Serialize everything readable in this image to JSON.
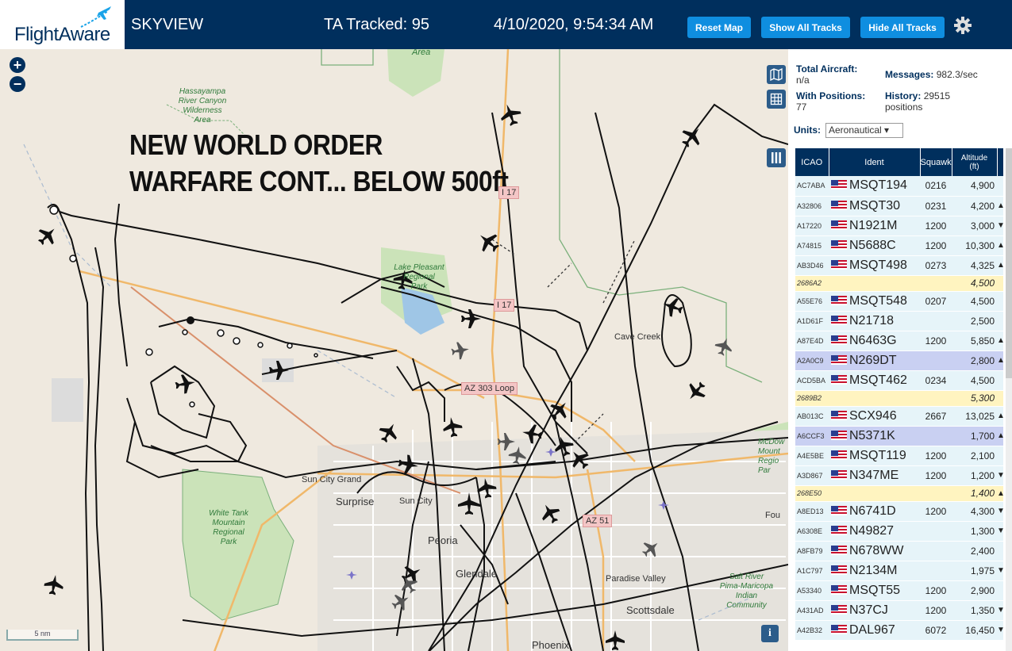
{
  "header": {
    "logo": "FlightAware",
    "app_name": "SKYVIEW",
    "tracked": "TA Tracked: 95",
    "datetime": "4/10/2020, 9:54:34 AM",
    "buttons": {
      "reset": "Reset Map",
      "show_all": "Show All Tracks",
      "hide_all": "Hide All Tracks"
    }
  },
  "map": {
    "zoom_in": "+",
    "zoom_out": "−",
    "overlay_line1": "NEW WORLD ORDER",
    "overlay_line2": "WARFARE CONT... BELOW 500ft",
    "scale": "5 nm",
    "info": "i",
    "places": {
      "sun_city_grand": "Sun City Grand",
      "surprise": "Surprise",
      "sun_city": "Sun City",
      "peoria": "Peoria",
      "glendale": "Glendale",
      "paradise_valley": "Paradise Valley",
      "scottsdale": "Scottsdale",
      "phoenix": "Phoenix",
      "cave_creek": "Cave Creek",
      "area": "Area",
      "fou": "Fou"
    },
    "green_labels": {
      "hassayampa": "Hassayampa\nRiver Canyon\nWilderness\nArea",
      "lake_pleasant": "Lake Pleasant\nRegional\nPark",
      "white_tank": "White Tank\nMountain\nRegional\nPark",
      "salt_river": "Salt River\nPima-Maricopa\nIndian\nCommunity",
      "mcdow": "McDow\nMount\nRegio\nPar"
    },
    "highways": {
      "i17_top": "I 17",
      "i17_mid": "I 17",
      "az303": "AZ 303 Loop",
      "az51": "AZ 51"
    }
  },
  "sidebar": {
    "total_aircraft_label": "Total Aircraft:",
    "total_aircraft_value": "n/a",
    "with_positions_label": "With Positions:",
    "with_positions_value": "77",
    "messages_label": "Messages:",
    "messages_value": "982.3/sec",
    "history_label": "History:",
    "history_value": "29515",
    "history_unit": "positions",
    "units_label": "Units:",
    "units_value": "Aeronautical ▾",
    "columns": [
      "ICAO",
      "Ident",
      "Squawk",
      "Altitude\n(ft)"
    ],
    "rows": [
      {
        "icao": "AC7ABA",
        "ident": "MSQT194",
        "squawk": "0216",
        "alt": "4,900",
        "trend": "",
        "style": "",
        "flag": true
      },
      {
        "icao": "A32806",
        "ident": "MSQT30",
        "squawk": "0231",
        "alt": "4,200",
        "trend": "▲",
        "style": "",
        "flag": true
      },
      {
        "icao": "A17220",
        "ident": "N1921M",
        "squawk": "1200",
        "alt": "3,000",
        "trend": "▼",
        "style": "",
        "flag": true
      },
      {
        "icao": "A74815",
        "ident": "N5688C",
        "squawk": "1200",
        "alt": "10,300",
        "trend": "▲",
        "style": "",
        "flag": true
      },
      {
        "icao": "AB3D46",
        "ident": "MSQT498",
        "squawk": "0273",
        "alt": "4,325",
        "trend": "▲",
        "style": "",
        "flag": true
      },
      {
        "icao": "2686A2",
        "ident": "",
        "squawk": "",
        "alt": "4,500",
        "trend": "",
        "style": "yellow",
        "flag": false
      },
      {
        "icao": "A55E76",
        "ident": "MSQT548",
        "squawk": "0207",
        "alt": "4,500",
        "trend": "",
        "style": "",
        "flag": true
      },
      {
        "icao": "A1D61F",
        "ident": "N21718",
        "squawk": "",
        "alt": "2,500",
        "trend": "",
        "style": "",
        "flag": true
      },
      {
        "icao": "A87E4D",
        "ident": "N6463G",
        "squawk": "1200",
        "alt": "5,850",
        "trend": "▲",
        "style": "",
        "flag": true
      },
      {
        "icao": "A2A0C9",
        "ident": "N269DT",
        "squawk": "",
        "alt": "2,800",
        "trend": "▲",
        "style": "purple",
        "flag": true
      },
      {
        "icao": "ACD5BA",
        "ident": "MSQT462",
        "squawk": "0234",
        "alt": "4,500",
        "trend": "",
        "style": "",
        "flag": true
      },
      {
        "icao": "2689B2",
        "ident": "",
        "squawk": "",
        "alt": "5,300",
        "trend": "",
        "style": "yellow",
        "flag": false
      },
      {
        "icao": "AB013C",
        "ident": "SCX946",
        "squawk": "2667",
        "alt": "13,025",
        "trend": "▲",
        "style": "",
        "flag": true
      },
      {
        "icao": "A6CCF3",
        "ident": "N5371K",
        "squawk": "",
        "alt": "1,700",
        "trend": "▲",
        "style": "purple",
        "flag": true
      },
      {
        "icao": "A4E5BE",
        "ident": "MSQT119",
        "squawk": "1200",
        "alt": "2,100",
        "trend": "",
        "style": "",
        "flag": true
      },
      {
        "icao": "A3D867",
        "ident": "N347ME",
        "squawk": "1200",
        "alt": "1,200",
        "trend": "▼",
        "style": "",
        "flag": true
      },
      {
        "icao": "268E50",
        "ident": "",
        "squawk": "",
        "alt": "1,400",
        "trend": "▲",
        "style": "yellow",
        "flag": false
      },
      {
        "icao": "A8ED13",
        "ident": "N6741D",
        "squawk": "1200",
        "alt": "4,300",
        "trend": "▼",
        "style": "",
        "flag": true
      },
      {
        "icao": "A6308E",
        "ident": "N49827",
        "squawk": "",
        "alt": "1,300",
        "trend": "▼",
        "style": "",
        "flag": true
      },
      {
        "icao": "A8FB79",
        "ident": "N678WW",
        "squawk": "",
        "alt": "2,400",
        "trend": "",
        "style": "",
        "flag": true
      },
      {
        "icao": "A1C797",
        "ident": "N2134M",
        "squawk": "",
        "alt": "1,975",
        "trend": "▼",
        "style": "",
        "flag": true
      },
      {
        "icao": "A53340",
        "ident": "MSQT55",
        "squawk": "1200",
        "alt": "2,900",
        "trend": "",
        "style": "",
        "flag": true
      },
      {
        "icao": "A431AD",
        "ident": "N37CJ",
        "squawk": "1200",
        "alt": "1,350",
        "trend": "▼",
        "style": "",
        "flag": true
      },
      {
        "icao": "A42B32",
        "ident": "DAL967",
        "squawk": "6072",
        "alt": "16,450",
        "trend": "▼",
        "style": "",
        "flag": true
      }
    ]
  },
  "colors": {
    "header_bg": "#002f5d",
    "button": "#0f8ee0",
    "row_bg": "#e6f4f9",
    "row_yellow": "#fff4c0",
    "row_selected": "#c9d0f2"
  }
}
